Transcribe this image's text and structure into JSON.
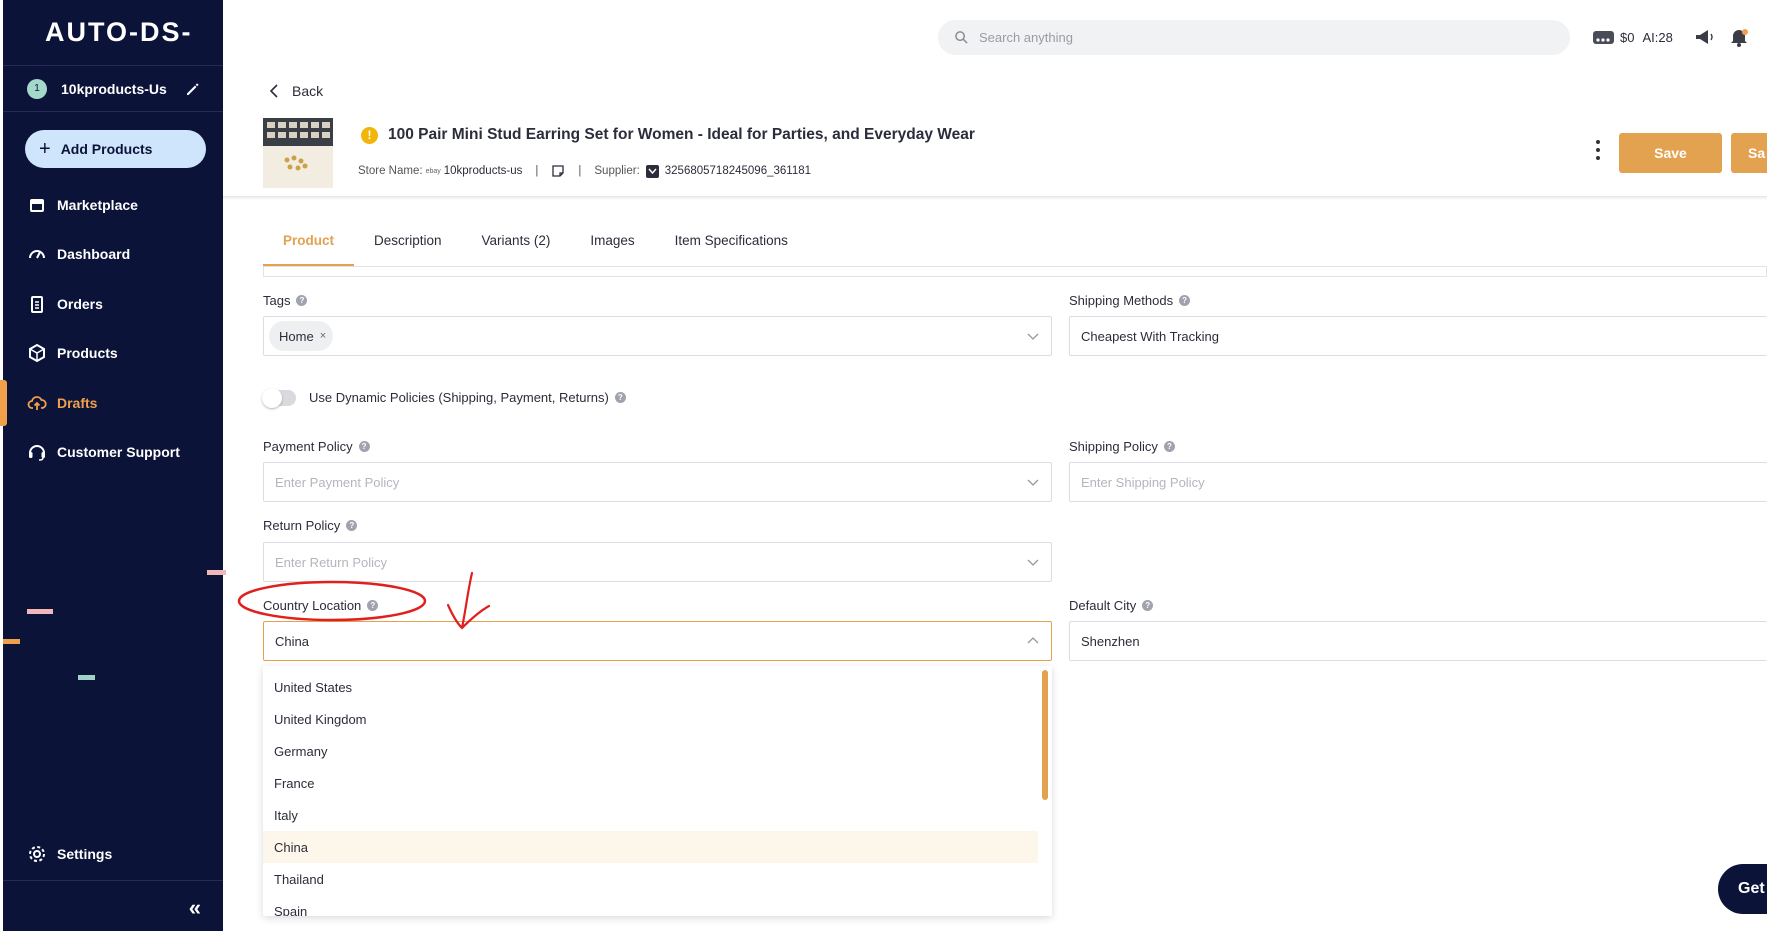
{
  "app": {
    "logo": "AUTO-DS-"
  },
  "sidebar": {
    "store": {
      "number": "1",
      "name": "10kproducts-Us"
    },
    "add_products": "Add Products",
    "items": [
      {
        "label": "Marketplace",
        "icon": "store-icon"
      },
      {
        "label": "Dashboard",
        "icon": "gauge-icon"
      },
      {
        "label": "Orders",
        "icon": "clipboard-icon"
      },
      {
        "label": "Products",
        "icon": "box-icon"
      },
      {
        "label": "Drafts",
        "icon": "cloud-upload-icon",
        "active": true
      },
      {
        "label": "Customer Support",
        "icon": "headset-icon"
      }
    ],
    "settings": "Settings",
    "collapse": "«"
  },
  "topbar": {
    "search_placeholder": "Search anything",
    "balance": "$0",
    "ai_credits": "AI:28"
  },
  "header": {
    "back": "Back",
    "title": "100 Pair Mini Stud Earring Set for Women - Ideal for Parties, and Everyday Wear",
    "store_label": "Store Name:",
    "store_marketplace": "ebay",
    "store_value": "10kproducts-us",
    "supplier_label": "Supplier:",
    "supplier_value": "3256805718245096_361181",
    "save": "Save",
    "save2": "Sa"
  },
  "tabs": [
    {
      "label": "Product",
      "active": true
    },
    {
      "label": "Description"
    },
    {
      "label": "Variants (2)"
    },
    {
      "label": "Images"
    },
    {
      "label": "Item Specifications"
    }
  ],
  "form": {
    "tags": {
      "label": "Tags",
      "chip": "Home",
      "remove": "×"
    },
    "shipping_methods": {
      "label": "Shipping Methods",
      "value": "Cheapest With Tracking"
    },
    "dynamic_policies": {
      "label": "Use Dynamic Policies (Shipping, Payment, Returns)",
      "enabled": false
    },
    "payment_policy": {
      "label": "Payment Policy",
      "placeholder": "Enter Payment Policy"
    },
    "shipping_policy": {
      "label": "Shipping Policy",
      "placeholder": "Enter Shipping Policy"
    },
    "return_policy": {
      "label": "Return Policy",
      "placeholder": "Enter Return Policy"
    },
    "country_location": {
      "label": "Country Location",
      "value": "China"
    },
    "default_city": {
      "label": "Default City",
      "value": "Shenzhen"
    }
  },
  "country_options": [
    "United States",
    "United Kingdom",
    "Germany",
    "France",
    "Italy",
    "China",
    "Thailand",
    "Spain"
  ],
  "selected_country_index": 5,
  "chat": {
    "label": "Get"
  },
  "colors": {
    "sidebar": "#0c1339",
    "accent": "#e3a24f",
    "annotation": "#e0201f"
  }
}
